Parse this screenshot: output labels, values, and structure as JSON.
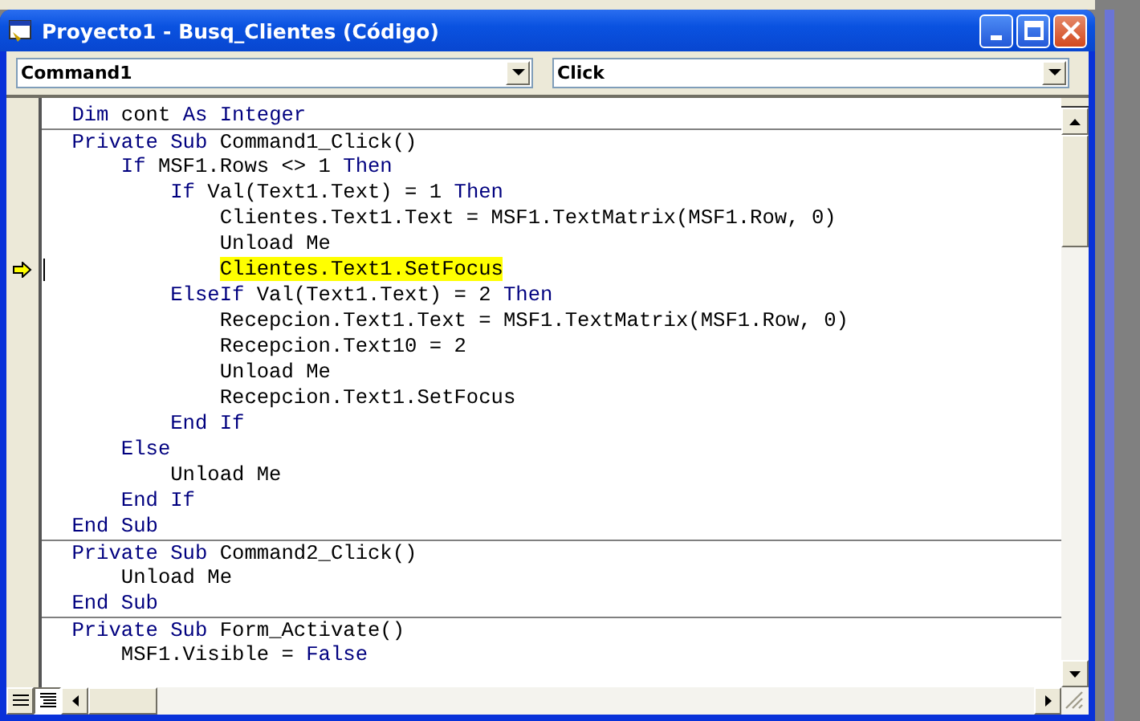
{
  "window": {
    "title": "Proyecto1 - Busq_Clientes (Código)"
  },
  "object_combo": {
    "value": "Command1"
  },
  "procedure_combo": {
    "value": "Click"
  },
  "sections": [
    {
      "lines": [
        {
          "execution_point": false,
          "segments": [
            {
              "text": "Dim",
              "kind": "keyword"
            },
            {
              "text": " cont ",
              "kind": "plain"
            },
            {
              "text": "As Integer",
              "kind": "keyword"
            }
          ]
        }
      ]
    },
    {
      "lines": [
        {
          "execution_point": false,
          "segments": [
            {
              "text": "Private Sub",
              "kind": "keyword"
            },
            {
              "text": " Command1_Click()",
              "kind": "plain"
            }
          ]
        },
        {
          "execution_point": false,
          "segments": [
            {
              "text": "    If",
              "kind": "keyword"
            },
            {
              "text": " MSF1.Rows <> 1 ",
              "kind": "plain"
            },
            {
              "text": "Then",
              "kind": "keyword"
            }
          ]
        },
        {
          "execution_point": false,
          "segments": [
            {
              "text": "        If",
              "kind": "keyword"
            },
            {
              "text": " Val(Text1.Text) = 1 ",
              "kind": "plain"
            },
            {
              "text": "Then",
              "kind": "keyword"
            }
          ]
        },
        {
          "execution_point": false,
          "segments": [
            {
              "text": "            Clientes.Text1.Text = MSF1.TextMatrix(MSF1.Row, 0)",
              "kind": "plain"
            }
          ]
        },
        {
          "execution_point": false,
          "segments": [
            {
              "text": "            Unload Me",
              "kind": "plain"
            }
          ]
        },
        {
          "execution_point": true,
          "segments": [
            {
              "text": "            Clientes.Text1.SetFocus",
              "kind": "highlight"
            }
          ]
        },
        {
          "execution_point": false,
          "segments": [
            {
              "text": "        ElseIf",
              "kind": "keyword"
            },
            {
              "text": " Val(Text1.Text) = 2 ",
              "kind": "plain"
            },
            {
              "text": "Then",
              "kind": "keyword"
            }
          ]
        },
        {
          "execution_point": false,
          "segments": [
            {
              "text": "            Recepcion.Text1.Text = MSF1.TextMatrix(MSF1.Row, 0)",
              "kind": "plain"
            }
          ]
        },
        {
          "execution_point": false,
          "segments": [
            {
              "text": "            Recepcion.Text10 = 2",
              "kind": "plain"
            }
          ]
        },
        {
          "execution_point": false,
          "segments": [
            {
              "text": "            Unload Me",
              "kind": "plain"
            }
          ]
        },
        {
          "execution_point": false,
          "segments": [
            {
              "text": "            Recepcion.Text1.SetFocus",
              "kind": "plain"
            }
          ]
        },
        {
          "execution_point": false,
          "segments": [
            {
              "text": "        End If",
              "kind": "keyword"
            }
          ]
        },
        {
          "execution_point": false,
          "segments": [
            {
              "text": "    Else",
              "kind": "keyword"
            }
          ]
        },
        {
          "execution_point": false,
          "segments": [
            {
              "text": "        Unload Me",
              "kind": "plain"
            }
          ]
        },
        {
          "execution_point": false,
          "segments": [
            {
              "text": "    End If",
              "kind": "keyword"
            }
          ]
        },
        {
          "execution_point": false,
          "segments": [
            {
              "text": "End Sub",
              "kind": "keyword"
            }
          ]
        }
      ]
    },
    {
      "lines": [
        {
          "execution_point": false,
          "segments": [
            {
              "text": "Private Sub",
              "kind": "keyword"
            },
            {
              "text": " Command2_Click()",
              "kind": "plain"
            }
          ]
        },
        {
          "execution_point": false,
          "segments": [
            {
              "text": "    Unload Me",
              "kind": "plain"
            }
          ]
        },
        {
          "execution_point": false,
          "segments": [
            {
              "text": "End Sub",
              "kind": "keyword"
            }
          ]
        }
      ]
    },
    {
      "lines": [
        {
          "execution_point": false,
          "segments": [
            {
              "text": "Private Sub",
              "kind": "keyword"
            },
            {
              "text": " Form_Activate()",
              "kind": "plain"
            }
          ]
        },
        {
          "execution_point": false,
          "segments": [
            {
              "text": "    MSF1.Visible = ",
              "kind": "plain"
            },
            {
              "text": "False",
              "kind": "keyword"
            }
          ]
        }
      ]
    }
  ],
  "view_buttons": [
    {
      "kind": "procedure",
      "selected": false
    },
    {
      "kind": "module",
      "selected": true
    }
  ]
}
